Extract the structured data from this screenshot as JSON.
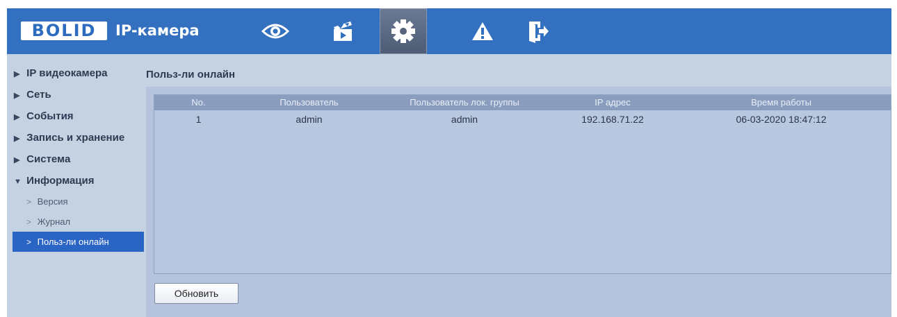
{
  "header": {
    "logo_text": "BOLID",
    "app_title": "IP-камера",
    "nav": [
      {
        "icon": "eye-icon",
        "active": false
      },
      {
        "icon": "clapperboard-icon",
        "active": false
      },
      {
        "icon": "gear-icon",
        "active": true
      },
      {
        "icon": "warning-icon",
        "active": false
      },
      {
        "icon": "logout-icon",
        "active": false
      }
    ]
  },
  "sidebar": {
    "items": [
      {
        "label": "IP видеокамера",
        "arrow": "▶"
      },
      {
        "label": "Сеть",
        "arrow": "▶"
      },
      {
        "label": "События",
        "arrow": "▶"
      },
      {
        "label": "Запись и хранение",
        "arrow": "▶"
      },
      {
        "label": "Система",
        "arrow": "▶"
      },
      {
        "label": "Информация",
        "arrow": "▼"
      }
    ],
    "sub_items": [
      {
        "label": "Версия",
        "chev": ">"
      },
      {
        "label": "Журнал",
        "chev": ">"
      },
      {
        "label": "Польз-ли онлайн",
        "chev": ">",
        "selected": true
      }
    ]
  },
  "main": {
    "title": "Польз-ли онлайн",
    "table": {
      "columns": [
        "No.",
        "Пользователь",
        "Пользователь лок. группы",
        "IP адрес",
        "Время работы"
      ],
      "rows": [
        [
          "1",
          "admin",
          "admin",
          "192.168.71.22",
          "06-03-2020 18:47:12"
        ]
      ]
    },
    "refresh_label": "Обновить"
  },
  "colors": {
    "topbar": "#3470c0",
    "content_bg": "#c5d2e2",
    "selected": "#2a64c4",
    "table_header": "#8a9dbf"
  }
}
